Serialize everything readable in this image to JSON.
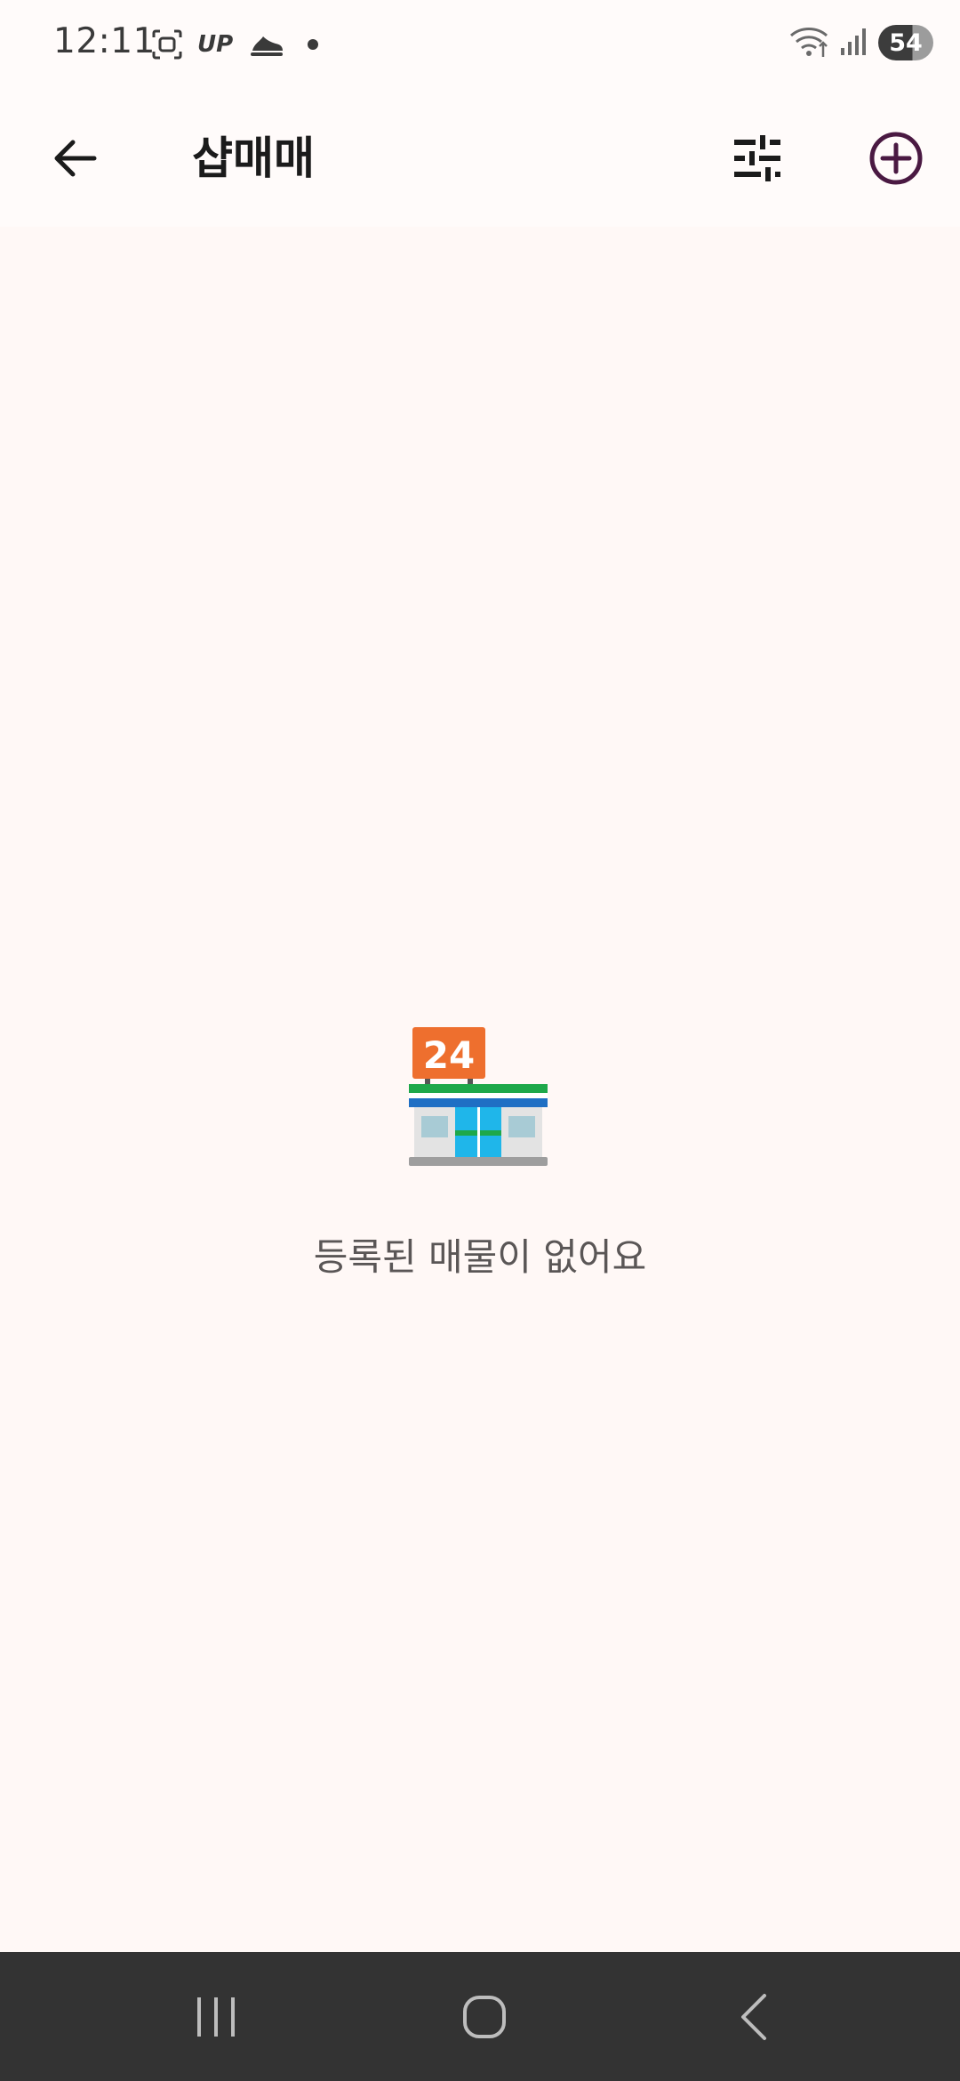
{
  "status_bar": {
    "time": "12:11",
    "up_label": "UP",
    "battery_level": "54",
    "icons": [
      "screenshot-icon",
      "up-icon",
      "shoe-icon",
      "notification-dot",
      "wifi-icon",
      "signal-icon",
      "battery-icon"
    ]
  },
  "app_bar": {
    "title": "샵매매",
    "icons": [
      "back-arrow-icon",
      "filter-sliders-icon",
      "add-circle-icon"
    ]
  },
  "empty_state": {
    "illustration": "convenience-store-24-icon",
    "badge_text": "24",
    "message": "등록된 매물이 없어요"
  },
  "nav_bar": {
    "icons": [
      "recent-apps-icon",
      "home-icon",
      "back-icon"
    ]
  },
  "colors": {
    "background": "#FFF8F6",
    "app_bar": "#FFFBFA",
    "accent": "#4A1942",
    "nav_bar": "#333333",
    "text_primary": "#1B1B1B",
    "text_secondary": "#5A5656"
  }
}
